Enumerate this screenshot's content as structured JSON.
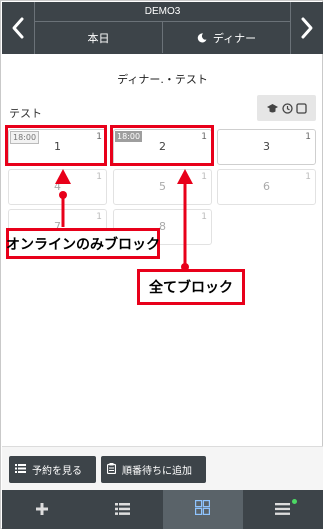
{
  "header": {
    "store_name": "DEMO3",
    "date_label": "本日",
    "meal_label": "ディナー",
    "meal_icon": "moon-icon",
    "prev_icon": "chevron-left-icon",
    "next_icon": "chevron-right-icon"
  },
  "main": {
    "title": "ディナー.・テスト",
    "section_label": "テスト",
    "view_icons": [
      "seat-icon",
      "clock-icon",
      "square-icon"
    ]
  },
  "tables": [
    {
      "number": "1",
      "capacity": "1",
      "time": "18:00",
      "time_style": "outline",
      "highlighted": true
    },
    {
      "number": "2",
      "capacity": "1",
      "time": "18:00",
      "time_style": "filled",
      "highlighted": true
    },
    {
      "number": "3",
      "capacity": "1",
      "time": "",
      "highlighted": false
    },
    {
      "number": "4",
      "capacity": "1",
      "time": "",
      "highlighted": false
    },
    {
      "number": "5",
      "capacity": "1",
      "time": "",
      "highlighted": false
    },
    {
      "number": "6",
      "capacity": "1",
      "time": "",
      "highlighted": false
    },
    {
      "number": "7",
      "capacity": "1",
      "time": "",
      "highlighted": false
    },
    {
      "number": "8",
      "capacity": "1",
      "time": "",
      "highlighted": false
    }
  ],
  "annotations": {
    "online_block": "オンラインのみブロック",
    "all_block": "全てブロック",
    "color": "#e8001a"
  },
  "actions": {
    "view_reservations": "予約を見る",
    "add_waitlist": "順番待ちに追加"
  },
  "tab_bar": {
    "tabs": [
      "plus-icon",
      "list-icon",
      "grid-icon",
      "menu-icon"
    ],
    "active_index": 2
  },
  "colors": {
    "header_bg": "#3d4449",
    "accent_red": "#e8001a",
    "badge_green": "#4cd964"
  }
}
